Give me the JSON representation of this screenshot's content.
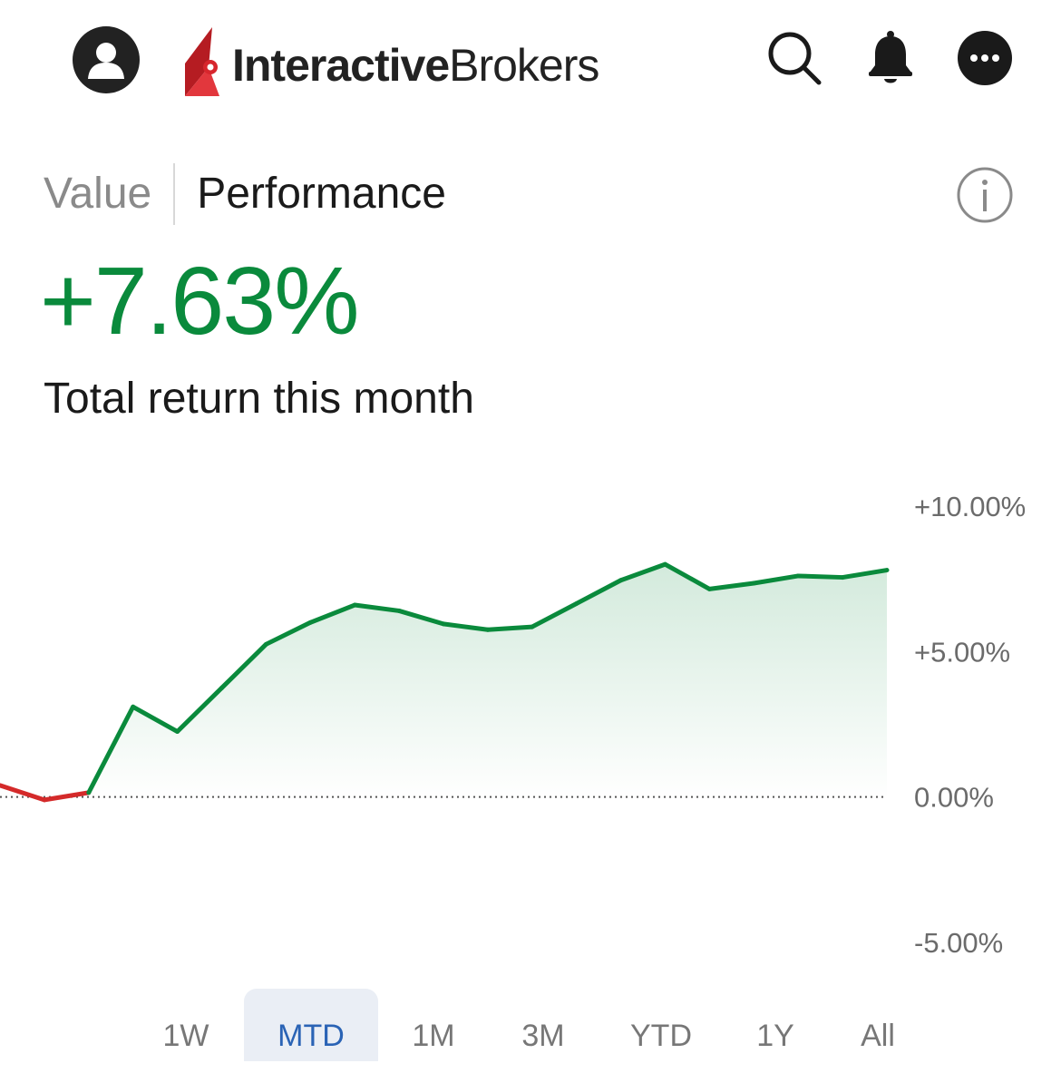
{
  "header": {
    "brand_bold": "Interactive",
    "brand_light": "Brokers",
    "icons": {
      "avatar": "user-avatar-icon",
      "search": "search-icon",
      "notifications": "bell-icon",
      "more": "more-icon"
    }
  },
  "tabs": [
    {
      "label": "Value",
      "active": false
    },
    {
      "label": "Performance",
      "active": true
    }
  ],
  "info_icon": "info-icon",
  "summary": {
    "value": "+7.63%",
    "caption": "Total return this month"
  },
  "colors": {
    "positive": "#0a8a3c",
    "negative": "#d42a2a",
    "active_range": "#2a63b5",
    "active_range_bg": "#eaeef5",
    "brand_red": "#d7262d"
  },
  "ranges": [
    {
      "label": "1W",
      "active": false
    },
    {
      "label": "MTD",
      "active": true
    },
    {
      "label": "1M",
      "active": false
    },
    {
      "label": "3M",
      "active": false
    },
    {
      "label": "YTD",
      "active": false
    },
    {
      "label": "1Y",
      "active": false
    },
    {
      "label": "All",
      "active": false
    }
  ],
  "chart_data": {
    "type": "area",
    "title": "",
    "xlabel": "",
    "ylabel": "",
    "ylim": [
      -5,
      10
    ],
    "ytick_labels": [
      "+10.00%",
      "+5.00%",
      "0.00%",
      "-5.00%"
    ],
    "yticks": [
      10,
      5,
      0,
      -5
    ],
    "baseline": 0,
    "grid": false,
    "series": [
      {
        "values": [
          0.4,
          -0.1,
          0.15,
          3.1,
          2.25,
          3.75,
          5.25,
          6.0,
          6.6,
          6.4,
          5.95,
          5.75,
          5.85,
          6.65,
          7.45,
          8.0,
          7.15,
          7.35,
          7.6,
          7.55,
          7.8
        ]
      }
    ]
  }
}
